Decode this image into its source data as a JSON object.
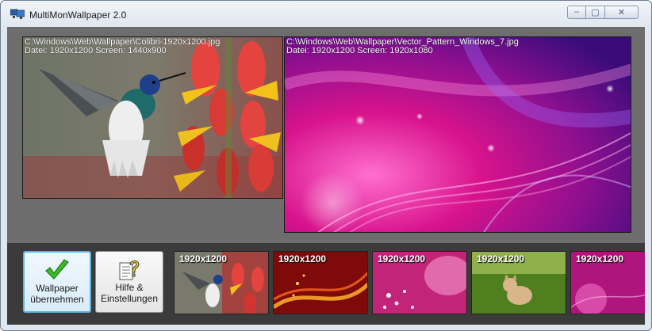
{
  "window": {
    "title": "MultiMonWallpaper 2.0",
    "controls": {
      "minimize": "–",
      "maximize": "▢",
      "close": "✕"
    }
  },
  "monitors": [
    {
      "path": "C:\\Windows\\Web\\Wallpaper\\Colibri-1920x1200.jpg",
      "info": "Datei: 1920x1200   Screen: 1440x900",
      "image": "hummingbird-and-red-flowers"
    },
    {
      "path": "C:\\Windows\\Web\\Wallpaper\\Vector_Pattern_Windows_7.jpg",
      "info": "Datei: 1920x1200   Screen: 1920x1080",
      "image": "magenta-purple-abstract-waves"
    }
  ],
  "buttons": {
    "apply": {
      "line1": "Wallpaper",
      "line2": "übernehmen",
      "icon": "checkmark-icon"
    },
    "help": {
      "line1": "Hilfe &",
      "line2": "Einstellungen",
      "icon": "help-document-icon"
    }
  },
  "thumbnails": [
    {
      "resolution": "1920x1200",
      "image": "hummingbird"
    },
    {
      "resolution": "1920x1200",
      "image": "red-golden-swirl"
    },
    {
      "resolution": "1920x1200",
      "image": "pink-floral"
    },
    {
      "resolution": "1920x1200",
      "image": "kitten-on-grass"
    },
    {
      "resolution": "1920x1200",
      "image": "magenta-pattern"
    }
  ],
  "colors": {
    "client_background": "#6b6b6b",
    "toolbar_background": "#3b3b3b",
    "selected_button_border": "#5eb3e8"
  }
}
